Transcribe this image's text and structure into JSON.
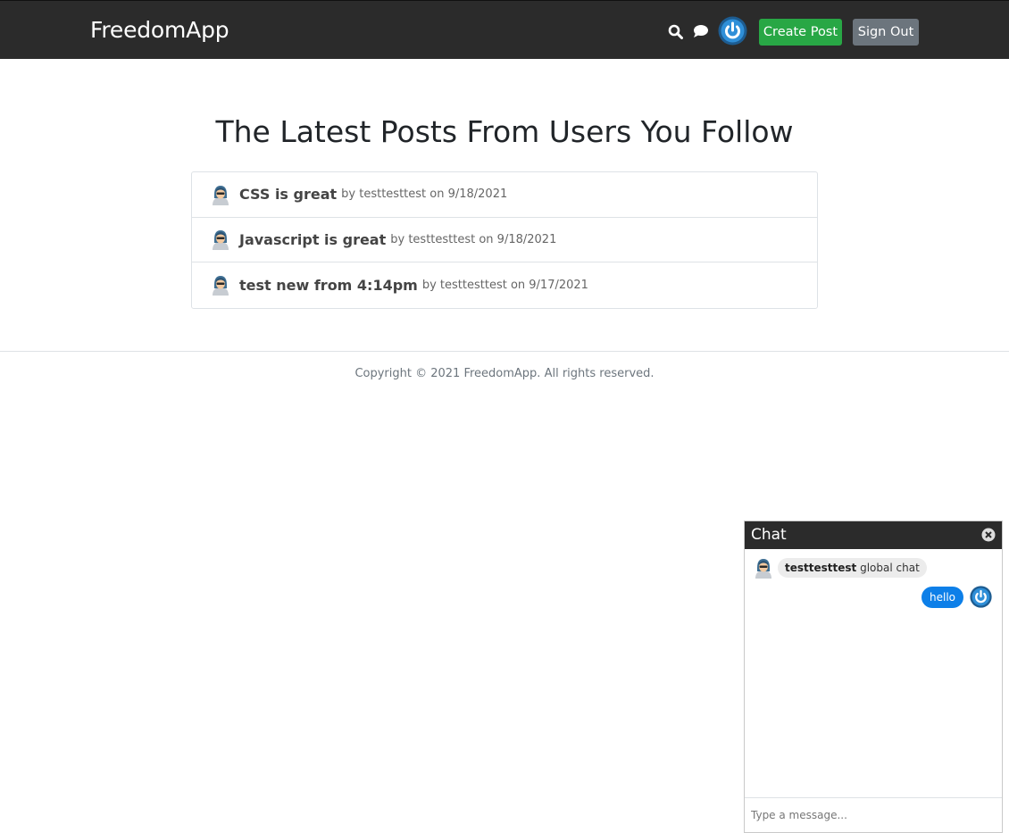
{
  "header": {
    "brand": "FreedomApp",
    "create_post_label": "Create Post",
    "sign_out_label": "Sign Out",
    "icons": [
      "search-icon",
      "chat-bubble-icon",
      "power-avatar-icon"
    ]
  },
  "main": {
    "title": "The Latest Posts From Users You Follow",
    "posts": [
      {
        "title": "CSS is great",
        "meta": "by testtesttest on 9/18/2021"
      },
      {
        "title": "Javascript is great",
        "meta": "by testtesttest on 9/18/2021"
      },
      {
        "title": "test new from 4:14pm",
        "meta": "by testtesttest on 9/17/2021"
      }
    ]
  },
  "footer": {
    "copyright": "Copyright © 2021 FreedomApp. All rights reserved."
  },
  "chat": {
    "title": "Chat",
    "messages": [
      {
        "user": "testtesttest",
        "text": "global chat"
      },
      {
        "text": "hello"
      }
    ],
    "input_placeholder": "Type a message..."
  },
  "colors": {
    "navbar": "#2b2b2b",
    "create_button": "#28a745",
    "sign_out_button": "#6c757d",
    "outgoing_bubble": "#0d7fe8"
  }
}
